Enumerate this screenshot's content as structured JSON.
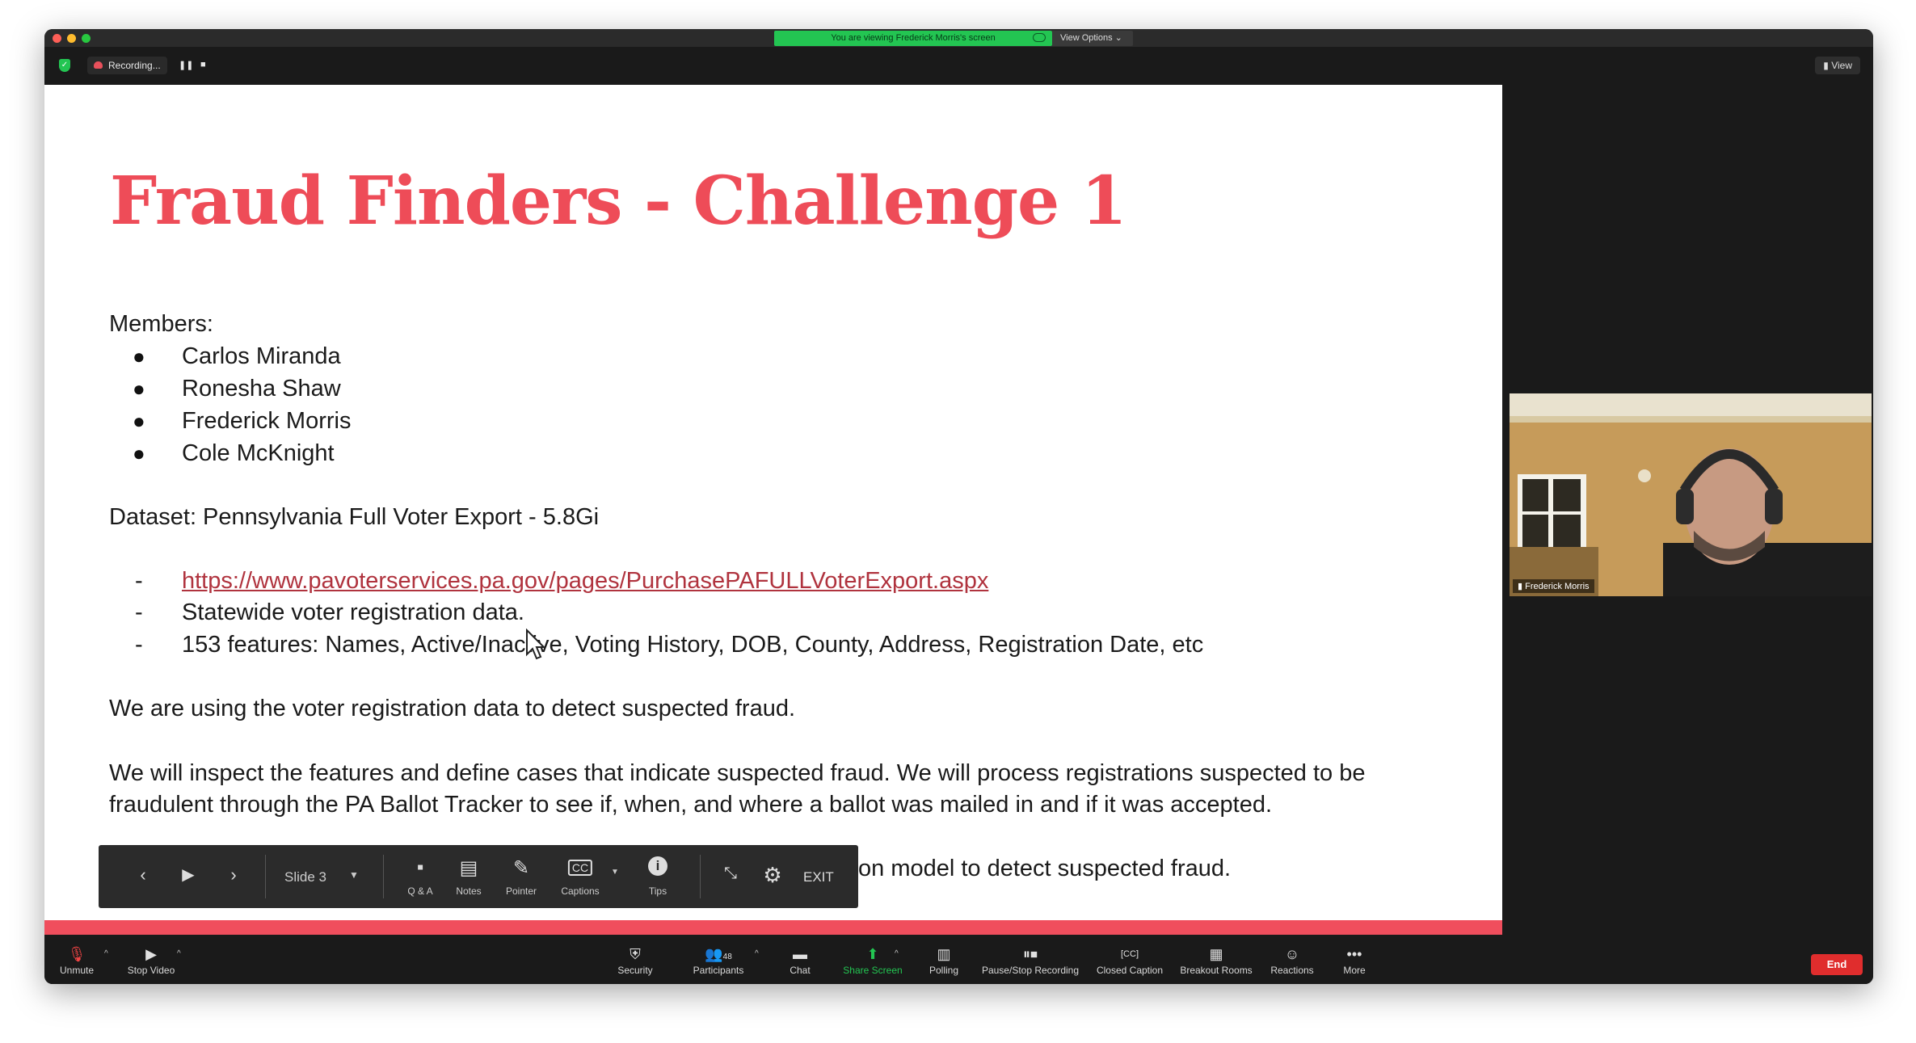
{
  "banner": {
    "text": "You are viewing Frederick Morris's screen",
    "view_options": "View Options ⌄"
  },
  "topbar": {
    "recording": "Recording...",
    "view": "View"
  },
  "slide": {
    "title": "Fraud Finders - Challenge 1",
    "members_label": "Members:",
    "members": [
      "Carlos Miranda",
      "Ronesha Shaw",
      "Frederick Morris",
      "Cole McKnight"
    ],
    "dataset": "Dataset: Pennsylvania Full Voter Export - 5.8Gi",
    "dataset_items": [
      "https://www.pavoterservices.pa.gov/pages/PurchasePAFULLVoterExport.aspx",
      "Statewide voter registration data.",
      "153 features: Names, Active/Inactive, Voting History, DOB, County, Address, Registration Date, etc"
    ],
    "para1": "We are using the voter registration data to detect suspected fraud.",
    "para2_line1": "We will inspect the features and define cases that indicate suspected fraud. We will process registrations suspected to be",
    "para2_line2": "fraudulent through the PA Ballot Tracker to see if, when, and where a ballot was mailed in and if it was accepted.",
    "para3_partial": "on model to detect suspected fraud."
  },
  "presenter_toolbar": {
    "slide_label": "Slide 3",
    "qa": "Q & A",
    "notes": "Notes",
    "pointer": "Pointer",
    "captions": "Captions",
    "tips": "Tips",
    "exit": "EXIT"
  },
  "video": {
    "name": "Frederick Morris"
  },
  "toolbar": {
    "unmute": "Unmute",
    "stop_video": "Stop Video",
    "security": "Security",
    "participants": "Participants",
    "participants_count": "48",
    "chat": "Chat",
    "share_screen": "Share Screen",
    "polling": "Polling",
    "pause_stop": "Pause/Stop Recording",
    "closed_caption": "Closed Caption",
    "breakout": "Breakout Rooms",
    "reactions": "Reactions",
    "more": "More",
    "end": "End"
  },
  "colors": {
    "accent_red": "#ee4c58",
    "share_green": "#23c552",
    "end_red": "#e02d2d"
  }
}
